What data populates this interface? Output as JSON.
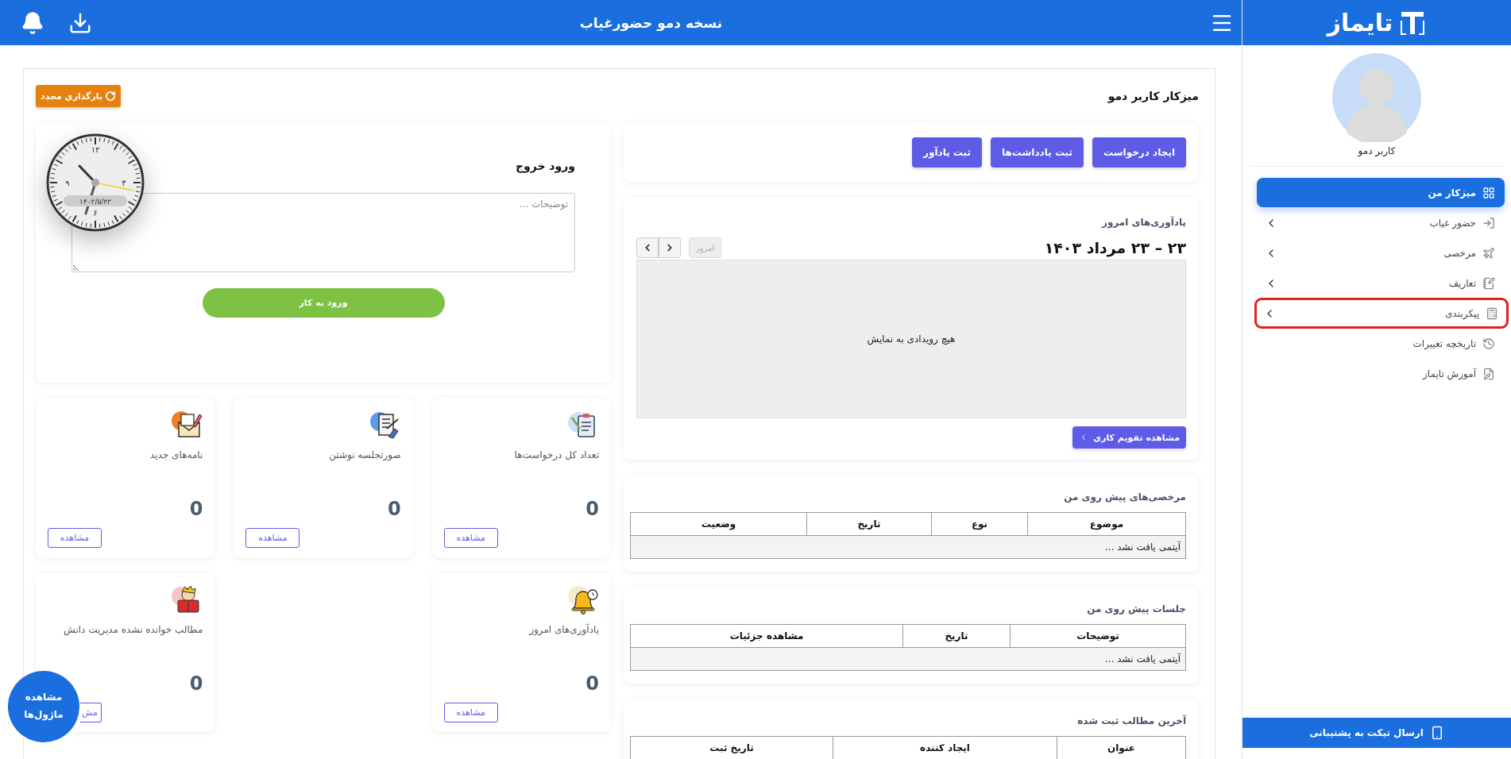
{
  "top_bar": {
    "title": "نسخه دمو حضورغیاب"
  },
  "sidebar": {
    "logo": "تایماز",
    "user_name": "کاربر دمو",
    "items": [
      {
        "kind": "dashboard",
        "label": "میزکار من",
        "selected": true,
        "expandable": false,
        "highlighted": false
      },
      {
        "kind": "attendance",
        "label": "حضور غیاب",
        "selected": false,
        "expandable": true,
        "highlighted": false
      },
      {
        "kind": "leave",
        "label": "مرخصی",
        "selected": false,
        "expandable": true,
        "highlighted": false
      },
      {
        "kind": "definitions",
        "label": "تعاریف",
        "selected": false,
        "expandable": true,
        "highlighted": false
      },
      {
        "kind": "config",
        "label": "پیکربندی",
        "selected": false,
        "expandable": true,
        "highlighted": true
      },
      {
        "kind": "changelog",
        "label": "تاریخچه تغییرات",
        "selected": false,
        "expandable": false,
        "highlighted": false
      },
      {
        "kind": "tutorial",
        "label": "آموزش تایماز",
        "selected": false,
        "expandable": false,
        "highlighted": false
      }
    ],
    "support_button": "ارسال تیکت به پشتیبانی"
  },
  "dashboard": {
    "title": "میزکار کاربر دمو",
    "reload_button": "بارگذاری مجدد",
    "actions": [
      "ایجاد درخواست",
      "ثبت یادداشت‌ها",
      "ثبت یادآور"
    ],
    "calendar": {
      "title": "یادآوری‌های امروز",
      "range": "۲۳ – ۲۳ مرداد ۱۴۰۳",
      "today_button": {
        "label": "امروز",
        "disabled": true
      },
      "empty_text": "هیچ رویدادی به نمایش",
      "link": "مشاهده تقویم کاری"
    },
    "tables": [
      {
        "title": "مرخصی‌های پیش روی من",
        "columns": [
          "موضوع",
          "نوع",
          "تاریخ",
          "وضعیت"
        ],
        "empty_text": "آیتمی یافت نشد ..."
      },
      {
        "title": "جلسات پیش روی من",
        "columns": [
          "توضیحات",
          "تاریخ",
          "مشاهده جزئیات"
        ],
        "empty_text": "آیتمی یافت نشد ..."
      },
      {
        "title": "آخرین مطالب ثبت شده",
        "columns": [
          "عنوان",
          "ایجاد کننده",
          "تاریخ ثبت"
        ]
      }
    ],
    "attendance": {
      "title": "ورود خروج",
      "placeholder": "توضیحات ...",
      "button": "ورود به کار",
      "clock": {
        "numerals": [
          "۱۲",
          "۳",
          "۶",
          "۹"
        ],
        "date": "۱۴۰۳/۵/۲۳"
      }
    },
    "stats": [
      {
        "kind": "requests",
        "label": "تعداد کل درخواست‌ها",
        "count": "0",
        "button": "مشاهده"
      },
      {
        "kind": "minutes",
        "label": "صورتجلسه نوشتن",
        "count": "0",
        "button": "مشاهده"
      },
      {
        "kind": "letters",
        "label": "نامه‌های جدید",
        "count": "0",
        "button": "مشاهده"
      },
      {
        "kind": "reminders",
        "label": "یادآوری‌های امروز",
        "count": "0",
        "button": "مشاهده"
      },
      {
        "kind": "knowledge",
        "label": "مطالب خوانده نشده مدیریت دانش",
        "count": "0",
        "button": "مش",
        "button_covered": true
      }
    ]
  },
  "modules_button": "مشاهده ماژول‌ها"
}
